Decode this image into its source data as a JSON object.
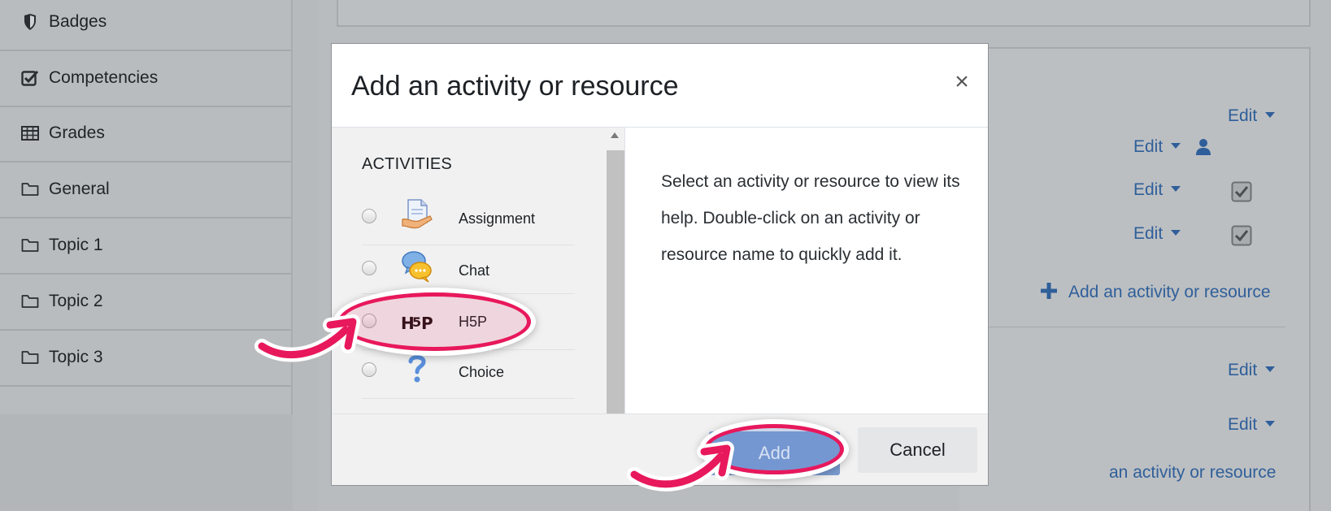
{
  "sidebar": {
    "items": [
      {
        "label": "Badges",
        "icon": "shield-icon"
      },
      {
        "label": "Competencies",
        "icon": "checkbox-icon"
      },
      {
        "label": "Grades",
        "icon": "table-icon"
      },
      {
        "label": "General",
        "icon": "folder-icon"
      },
      {
        "label": "Topic 1",
        "icon": "folder-icon"
      },
      {
        "label": "Topic 2",
        "icon": "folder-icon"
      },
      {
        "label": "Topic 3",
        "icon": "folder-icon"
      }
    ]
  },
  "background": {
    "edit_label": "Edit",
    "add_activity_label": "Add an activity or resource",
    "add_activity_partial": "an activity or resource",
    "link_color": "#2f5f9a"
  },
  "modal": {
    "title": "Add an activity or resource",
    "close_label": "×",
    "section_label": "ACTIVITIES",
    "options": [
      {
        "label": "Assignment",
        "icon": "assignment-icon"
      },
      {
        "label": "Chat",
        "icon": "chat-icon"
      },
      {
        "label": "H5P",
        "icon": "h5p-icon"
      },
      {
        "label": "Choice",
        "icon": "choice-icon"
      }
    ],
    "help_text": "Select an activity or resource to view its help. Double-click on an activity or resource name to quickly add it.",
    "add_button": "Add",
    "cancel_button": "Cancel"
  },
  "annotations": {
    "highlight_color": "#e8185c",
    "highlighted": [
      "H5P",
      "Add"
    ]
  }
}
